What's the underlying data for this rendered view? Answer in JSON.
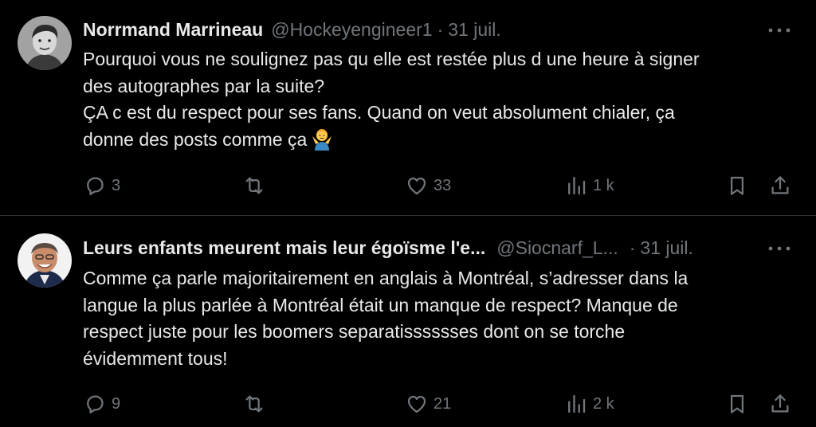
{
  "colors": {
    "background": "#000000",
    "text_primary": "#e7e9ea",
    "text_secondary": "#71767b",
    "divider": "#2f3336"
  },
  "tweets": [
    {
      "author_name": "Norrmand Marrineau",
      "handle": "@Hockeyengineer1",
      "separator": "·",
      "date": "31 juil.",
      "more_icon": "more-horizontal-icon",
      "text_lines": [
        "Pourquoi vous ne soulignez pas qu elle est restée plus d une heure à signer",
        "des autographes par la suite?",
        "ÇA c est du respect pour ses fans. Quand on veut absolument chialer, ça",
        "donne des posts comme ça"
      ],
      "emoji": "person-shrugging-emoji",
      "replies": "3",
      "retweets": "",
      "likes": "33",
      "views": "1 k"
    },
    {
      "author_name": "Leurs enfants meurent mais leur égoïsme l'e...",
      "handle": "@Siocnarf_L...",
      "separator": "·",
      "date": "31 juil.",
      "more_icon": "more-horizontal-icon",
      "text_lines": [
        "Comme ça parle majoritairement en anglais à Montréal, s’adresser dans la",
        "langue la plus parlée à Montréal était un manque de respect?  Manque de",
        "respect juste pour les boomers separatisssssses dont on se torche",
        "évidemment tous!"
      ],
      "replies": "9",
      "retweets": "",
      "likes": "21",
      "views": "2 k"
    }
  ]
}
